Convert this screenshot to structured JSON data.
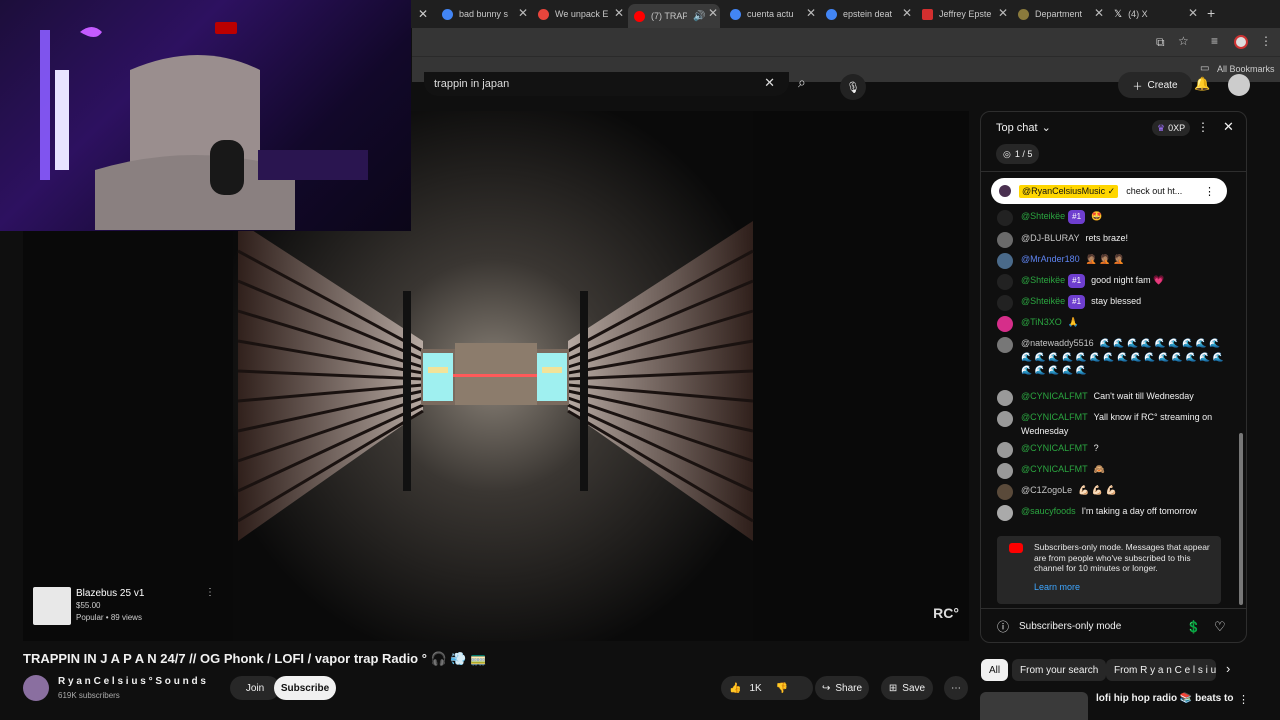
{
  "browser": {
    "tabs": [
      {
        "title": "bad bunny s",
        "fav": "#4285f4"
      },
      {
        "title": "We unpack E",
        "fav": "#e8453c"
      },
      {
        "title": "(7) TRAP",
        "fav": "#ff0000",
        "active": true
      },
      {
        "title": "cuenta actu",
        "fav": "#4285f4"
      },
      {
        "title": "epstein deat",
        "fav": "#4285f4"
      },
      {
        "title": "Jeffrey Epste",
        "fav": "#d32f2f"
      },
      {
        "title": "Department",
        "fav": "#8a7a3c"
      },
      {
        "title": "(4) X",
        "fav": "#000000"
      }
    ],
    "new_tab": "+",
    "bookmarks_label": "All Bookmarks"
  },
  "youtube": {
    "search_value": "trappin in japan",
    "create_label": "Create"
  },
  "video": {
    "watermark": "RC°",
    "product": {
      "name": "Blazebus 25 v1",
      "price": "$55.00",
      "meta": "Popular • 89 views"
    }
  },
  "below": {
    "title": "TRAPPIN IN  J A P A N 24/7 // OG Phonk / LOFI / vapor trap Radio ° 🎧 💨 🚃",
    "channel_name": "R y a n C e l s i u s ° S o u n d s",
    "subscribers": "619K subscribers",
    "join": "Join",
    "subscribe": "Subscribe",
    "likes": "1K",
    "share": "Share",
    "save": "Save"
  },
  "chat": {
    "header": "Top chat",
    "xp": "0XP",
    "poll": "1 / 5",
    "pinned": {
      "author": "@RyanCelsiusMusic ✓",
      "text": "check out ht..."
    },
    "messages": [
      {
        "author": "@Shteikëe",
        "class": "member",
        "badge": "#1",
        "text": "🤩",
        "avatar": "#222"
      },
      {
        "author": "@DJ-BLURAY",
        "class": "",
        "badge": "",
        "text": "rets braze!",
        "avatar": "#6a6a6a"
      },
      {
        "author": "@MrAnder180",
        "class": "mod",
        "badge": "",
        "text": "🤦🏽 🤦🏽 🤦🏽",
        "avatar": "#4a6a8a"
      },
      {
        "author": "@Shteikëe",
        "class": "member",
        "badge": "#1",
        "text": "good night fam 💗",
        "avatar": "#222"
      },
      {
        "author": "@Shteikëe",
        "class": "member",
        "badge": "#1",
        "text": "stay blessed",
        "avatar": "#222"
      },
      {
        "author": "@TiN3XO",
        "class": "member",
        "badge": "",
        "text": "🙏",
        "avatar": "#d62e8a"
      },
      {
        "author": "@natewaddy5516",
        "class": "",
        "badge": "",
        "text": "🌊 🌊 🌊 🌊 🌊 🌊 🌊 🌊 🌊 🌊 🌊 🌊 🌊 🌊 🌊 🌊 🌊 🌊 🌊 🌊 🌊 🌊 🌊 🌊 🌊 🌊 🌊 🌊 🌊",
        "avatar": "#777"
      },
      {
        "author": "@CYNICALFMT",
        "class": "member",
        "badge": "",
        "text": "Can't wait till Wednesday",
        "avatar": "#999"
      },
      {
        "author": "@CYNICALFMT",
        "class": "member",
        "badge": "",
        "text": "Yall know if RC° streaming on Wednesday",
        "avatar": "#999"
      },
      {
        "author": "@CYNICALFMT",
        "class": "member",
        "badge": "",
        "text": "?",
        "avatar": "#999"
      },
      {
        "author": "@CYNICALFMT",
        "class": "member",
        "badge": "",
        "text": "🙈",
        "avatar": "#999"
      },
      {
        "author": "@C1ZogoLe",
        "class": "",
        "badge": "",
        "text": "💪🏻 💪🏻 💪🏻",
        "avatar": "#5a4a3a"
      },
      {
        "author": "@saucyfoods",
        "class": "member",
        "badge": "",
        "text": "I'm taking a day off tomorrow",
        "avatar": "#aaa"
      }
    ],
    "notice_text": "Subscribers-only mode. Messages that appear are from people who've subscribed to this channel for 10 minutes or longer.",
    "learn_more": "Learn more",
    "footer_mode": "Subscribers-only mode"
  },
  "chips": [
    "All",
    "From your search",
    "From R y a n C e l s i u s"
  ],
  "rec": {
    "title": "lofi hip hop radio 📚 beats to"
  }
}
